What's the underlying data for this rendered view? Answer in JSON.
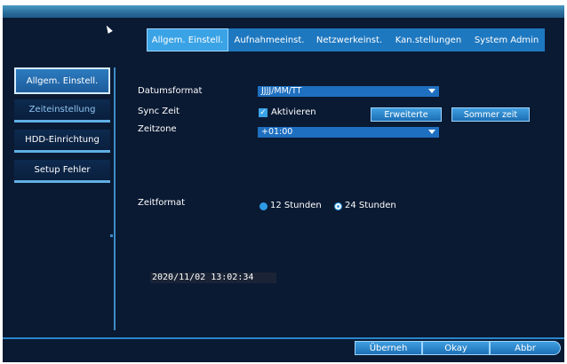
{
  "tabs": [
    {
      "label": "Allgem. Einstell.",
      "active": true
    },
    {
      "label": "Aufnahmeeinst.",
      "active": false
    },
    {
      "label": "Netzwerkeinst.",
      "active": false
    },
    {
      "label": "Kan.stellungen",
      "active": false
    },
    {
      "label": "System Admin",
      "active": false
    }
  ],
  "sidebar": {
    "items": [
      {
        "label": "Allgem. Einstell.",
        "active": true
      },
      {
        "label": "Zeiteinstellung",
        "active": false,
        "highlighted": true
      },
      {
        "label": "HDD-Einrichtung",
        "active": false
      },
      {
        "label": "Setup Fehler",
        "active": false
      }
    ]
  },
  "form": {
    "date_format_label": "Datumsformat",
    "date_format_value": "JJJJ/MM/TT",
    "sync_label": "Sync Zeit",
    "sync_checkbox_label": "Aktivieren",
    "sync_checked": true,
    "advanced_button": "Erweiterte",
    "summer_time_button": "Sommer zeit",
    "timezone_label": "Zeitzone",
    "timezone_value": "+01:00",
    "time_format_label": "Zeitformat",
    "time_format_option_12": "12 Stunden",
    "time_format_option_24": "24 Stunden",
    "time_format_selected": "24 Stunden",
    "current_time": "2020/11/02 13:02:34"
  },
  "footer": {
    "apply_label": "Überneh",
    "ok_label": "Okay",
    "cancel_label": "Abbr"
  },
  "colors": {
    "background": "#0a1a33",
    "accent": "#1e78c0",
    "active_tab": "#3aa3e6"
  }
}
